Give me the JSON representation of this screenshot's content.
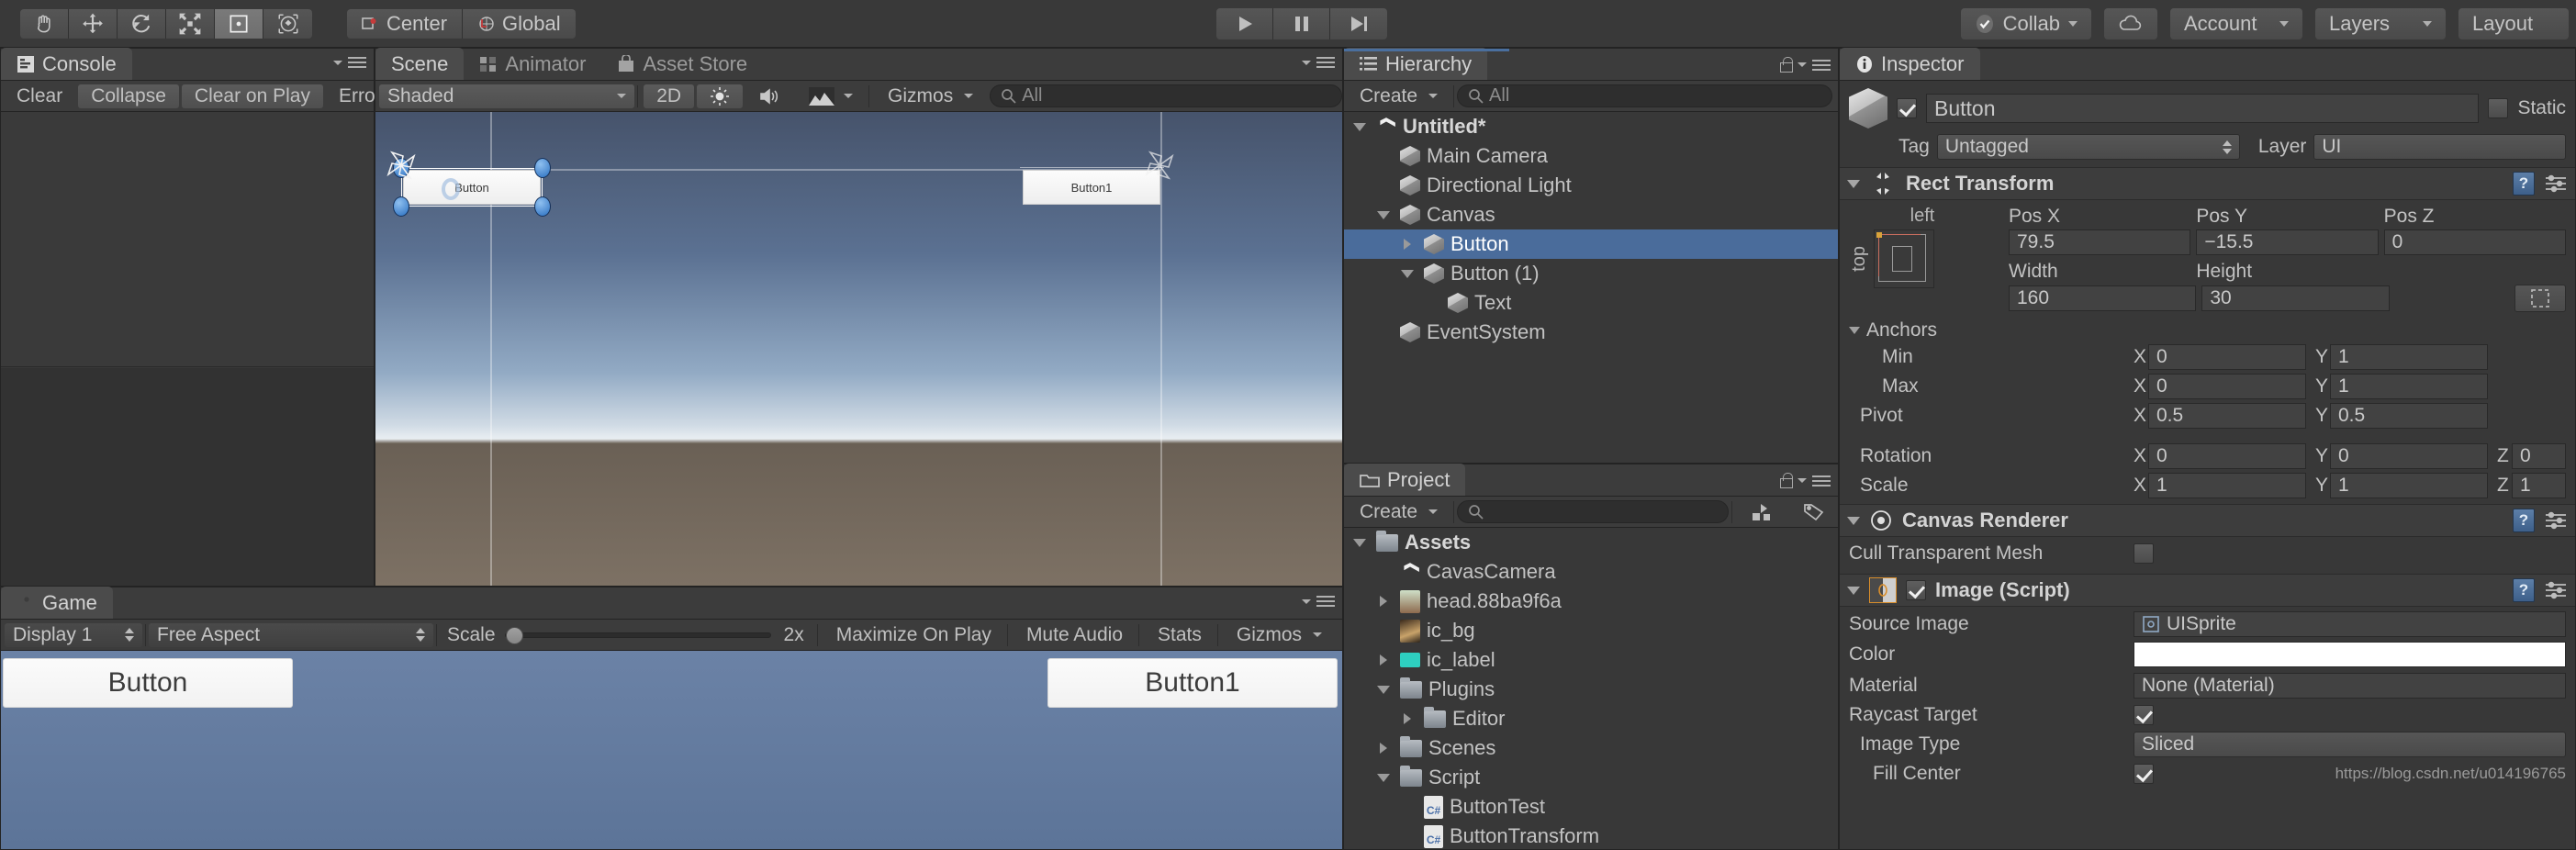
{
  "toolbar": {
    "tools": [
      {
        "name": "hand-tool",
        "label": "Hand",
        "active": false
      },
      {
        "name": "move-tool",
        "label": "Move",
        "active": false
      },
      {
        "name": "rotate-tool",
        "label": "Rotate",
        "active": false
      },
      {
        "name": "scale-tool",
        "label": "Scale",
        "active": false
      },
      {
        "name": "rect-tool",
        "label": "Rect Transform",
        "active": true
      },
      {
        "name": "transform-tool",
        "label": "Transform",
        "active": false
      }
    ],
    "pivot_mode": "Center",
    "pivot_rotation": "Global",
    "play": "play-button",
    "pause": "pause-button",
    "step": "step-button",
    "collab": "Collab",
    "cloud": "cloud-icon",
    "account": "Account",
    "layers": "Layers",
    "layout": "Layout"
  },
  "console": {
    "tab": "Console",
    "buttons": [
      "Clear",
      "Collapse",
      "Clear on Play",
      "Error Pau"
    ]
  },
  "scene": {
    "tabs": [
      {
        "label": "Scene",
        "icon": "scene-icon",
        "active": true
      },
      {
        "label": "Animator",
        "icon": "animator-icon",
        "active": false
      },
      {
        "label": "Asset Store",
        "icon": "asset-store-icon",
        "active": false
      }
    ],
    "draw_mode": "Shaded",
    "mode_2d": "2D",
    "lighting": "lighting-icon",
    "audio": "audio-icon",
    "fx": "fx-icon",
    "gizmos": "Gizmos",
    "search_placeholder": "All",
    "objects": [
      {
        "label": "Button",
        "selected": true
      },
      {
        "label": "Button1",
        "selected": false
      }
    ]
  },
  "game": {
    "tab": "Game",
    "display": "Display 1",
    "aspect": "Free Aspect",
    "scale_label": "Scale",
    "scale_value": "2x",
    "maximize": "Maximize On Play",
    "mute": "Mute Audio",
    "stats": "Stats",
    "gizmos": "Gizmos",
    "buttons": [
      {
        "label": "Button"
      },
      {
        "label": "Button1"
      }
    ]
  },
  "hierarchy": {
    "tab": "Hierarchy",
    "create": "Create",
    "search_placeholder": "All",
    "items": [
      {
        "label": "Untitled*",
        "depth": 0,
        "icon": "unity-icon",
        "twist": "open",
        "bold": true,
        "selected": false
      },
      {
        "label": "Main Camera",
        "depth": 1,
        "icon": "cube-icon",
        "twist": "none",
        "bold": false,
        "selected": false
      },
      {
        "label": "Directional Light",
        "depth": 1,
        "icon": "cube-icon",
        "twist": "none",
        "bold": false,
        "selected": false
      },
      {
        "label": "Canvas",
        "depth": 1,
        "icon": "cube-icon",
        "twist": "open",
        "bold": false,
        "selected": false
      },
      {
        "label": "Button",
        "depth": 2,
        "icon": "cube-icon",
        "twist": "closed",
        "bold": false,
        "selected": true
      },
      {
        "label": "Button (1)",
        "depth": 2,
        "icon": "cube-icon",
        "twist": "open",
        "bold": false,
        "selected": false
      },
      {
        "label": "Text",
        "depth": 3,
        "icon": "cube-icon",
        "twist": "none",
        "bold": false,
        "selected": false
      },
      {
        "label": "EventSystem",
        "depth": 1,
        "icon": "cube-icon",
        "twist": "none",
        "bold": false,
        "selected": false
      }
    ]
  },
  "project": {
    "tab": "Project",
    "create": "Create",
    "search_placeholder": "",
    "items": [
      {
        "label": "Assets",
        "depth": 0,
        "icon": "folder-icon",
        "twist": "open",
        "bold": true
      },
      {
        "label": "CavasCamera",
        "depth": 1,
        "icon": "unity-icon",
        "twist": "none",
        "bold": false
      },
      {
        "label": "head.88ba9f6a",
        "depth": 1,
        "icon": "image-thumb-head",
        "twist": "closed",
        "bold": false
      },
      {
        "label": "ic_bg",
        "depth": 1,
        "icon": "image-thumb-bg",
        "twist": "none",
        "bold": false
      },
      {
        "label": "ic_label",
        "depth": 1,
        "icon": "image-thumb-label",
        "twist": "closed",
        "bold": false
      },
      {
        "label": "Plugins",
        "depth": 1,
        "icon": "folder-icon",
        "twist": "open",
        "bold": false
      },
      {
        "label": "Editor",
        "depth": 2,
        "icon": "folder-icon",
        "twist": "closed",
        "bold": false
      },
      {
        "label": "Scenes",
        "depth": 1,
        "icon": "folder-icon",
        "twist": "closed",
        "bold": false
      },
      {
        "label": "Script",
        "depth": 1,
        "icon": "folder-icon",
        "twist": "open",
        "bold": false
      },
      {
        "label": "ButtonTest",
        "depth": 2,
        "icon": "csharp-icon",
        "twist": "none",
        "bold": false
      },
      {
        "label": "ButtonTransform",
        "depth": 2,
        "icon": "csharp-icon",
        "twist": "none",
        "bold": false
      }
    ]
  },
  "inspector": {
    "tab": "Inspector",
    "object_name": "Button",
    "enabled": true,
    "static_label": "Static",
    "static_checked": false,
    "tag_label": "Tag",
    "tag_value": "Untagged",
    "layer_label": "Layer",
    "layer_value": "UI",
    "rect_transform": {
      "title": "Rect Transform",
      "anchor_preset_h": "left",
      "anchor_preset_v": "top",
      "pos_x_label": "Pos X",
      "pos_x": "79.5",
      "pos_y_label": "Pos Y",
      "pos_y": "−15.5",
      "pos_z_label": "Pos Z",
      "pos_z": "0",
      "width_label": "Width",
      "width": "160",
      "height_label": "Height",
      "height": "30",
      "anchors_label": "Anchors",
      "min_label": "Min",
      "min_x": "0",
      "min_y": "1",
      "max_label": "Max",
      "max_x": "0",
      "max_y": "1",
      "pivot_label": "Pivot",
      "pivot_x": "0.5",
      "pivot_y": "0.5",
      "rotation_label": "Rotation",
      "rot_x": "0",
      "rot_y": "0",
      "rot_z": "0",
      "scale_label": "Scale",
      "scale_x": "1",
      "scale_y": "1",
      "scale_z": "1"
    },
    "canvas_renderer": {
      "title": "Canvas Renderer",
      "cull_label": "Cull Transparent Mesh",
      "cull_checked": false
    },
    "image_script": {
      "title": "Image (Script)",
      "enabled": true,
      "source_image_label": "Source Image",
      "source_image_value": "UISprite",
      "color_label": "Color",
      "color_value": "#FFFFFF",
      "material_label": "Material",
      "material_value": "None (Material)",
      "raycast_label": "Raycast Target",
      "raycast_checked": true,
      "image_type_label": "Image Type",
      "image_type_value": "Sliced",
      "fill_center_label": "Fill Center",
      "fill_center_checked": true
    },
    "watermark": "https://blog.csdn.net/u014196765"
  }
}
